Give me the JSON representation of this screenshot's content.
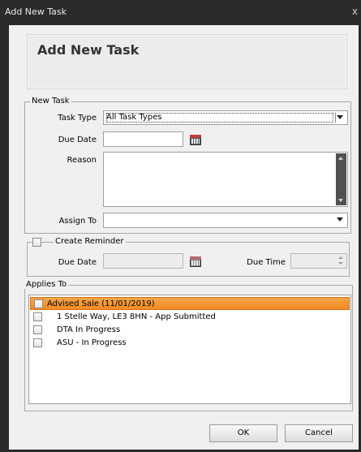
{
  "window": {
    "title": "Add New Task",
    "close_glyph": "x"
  },
  "header": {
    "title": "Add New Task"
  },
  "new_task": {
    "legend": "New Task",
    "task_type_label": "Task Type",
    "task_type_value": "All Task Types",
    "due_date_label": "Due Date",
    "due_date_value": "",
    "reason_label": "Reason",
    "reason_value": "",
    "assign_to_label": "Assign To",
    "assign_to_value": ""
  },
  "reminder": {
    "legend": "Create Reminder",
    "checked": false,
    "due_date_label": "Due Date",
    "due_date_value": "",
    "due_time_label": "Due Time",
    "due_time_value": ""
  },
  "applies_to": {
    "legend": "Applies To",
    "items": [
      {
        "label": "Advised Sale (11/01/2019)",
        "checked": false,
        "selected": true,
        "indent": 0
      },
      {
        "label": "1 Stelle Way, LE3 8HN - App Submitted",
        "checked": false,
        "selected": false,
        "indent": 1
      },
      {
        "label": "DTA In Progress",
        "checked": false,
        "selected": false,
        "indent": 1
      },
      {
        "label": "ASU - In Progress",
        "checked": false,
        "selected": false,
        "indent": 1
      }
    ]
  },
  "buttons": {
    "ok": "OK",
    "cancel": "Cancel"
  },
  "icons": {
    "calendar": "calendar-icon",
    "dropdown": "chevron-down-icon",
    "close": "close-icon"
  },
  "colors": {
    "selection": "#f28a22",
    "titlebar": "#2b2b2b"
  }
}
